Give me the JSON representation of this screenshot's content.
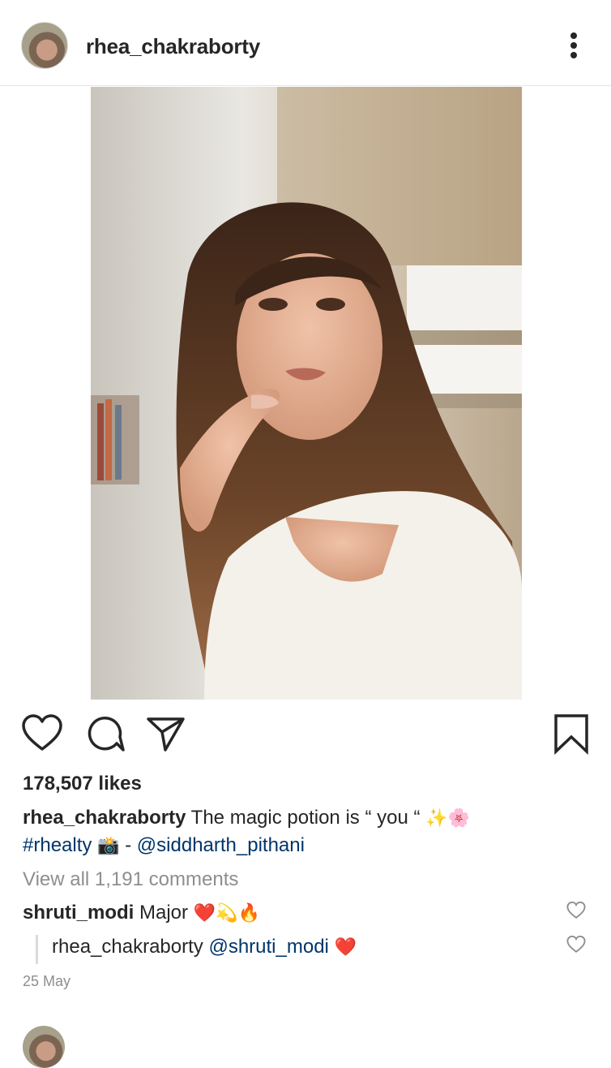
{
  "post": {
    "username": "rhea_chakraborty",
    "likes": "178,507 likes",
    "caption": {
      "username": "rhea_chakraborty",
      "text": " The magic potion is “ you “ ",
      "emoji1": "✨🌸",
      "hashtag": "#rhealty",
      "emoji2": "📸",
      "separator": " - ",
      "mention": "@siddharth_pithani"
    },
    "view_all": "View all 1,191 comments",
    "comments": [
      {
        "username": "shruti_modi",
        "text": " Major ",
        "emoji": "❤️💫🔥"
      },
      {
        "username": "rhea_chakraborty",
        "mention": "@shruti_modi",
        "emoji": "❤️"
      }
    ],
    "date": "25 May"
  },
  "icons": {
    "like": "heart-icon",
    "comment": "comment-icon",
    "share": "send-icon",
    "save": "bookmark-icon",
    "more": "more-vertical-icon",
    "comment_like": "heart-icon"
  },
  "colors": {
    "text": "#262626",
    "link": "#003569",
    "muted": "#8e8e8e",
    "heart_red": "#e0182b"
  }
}
